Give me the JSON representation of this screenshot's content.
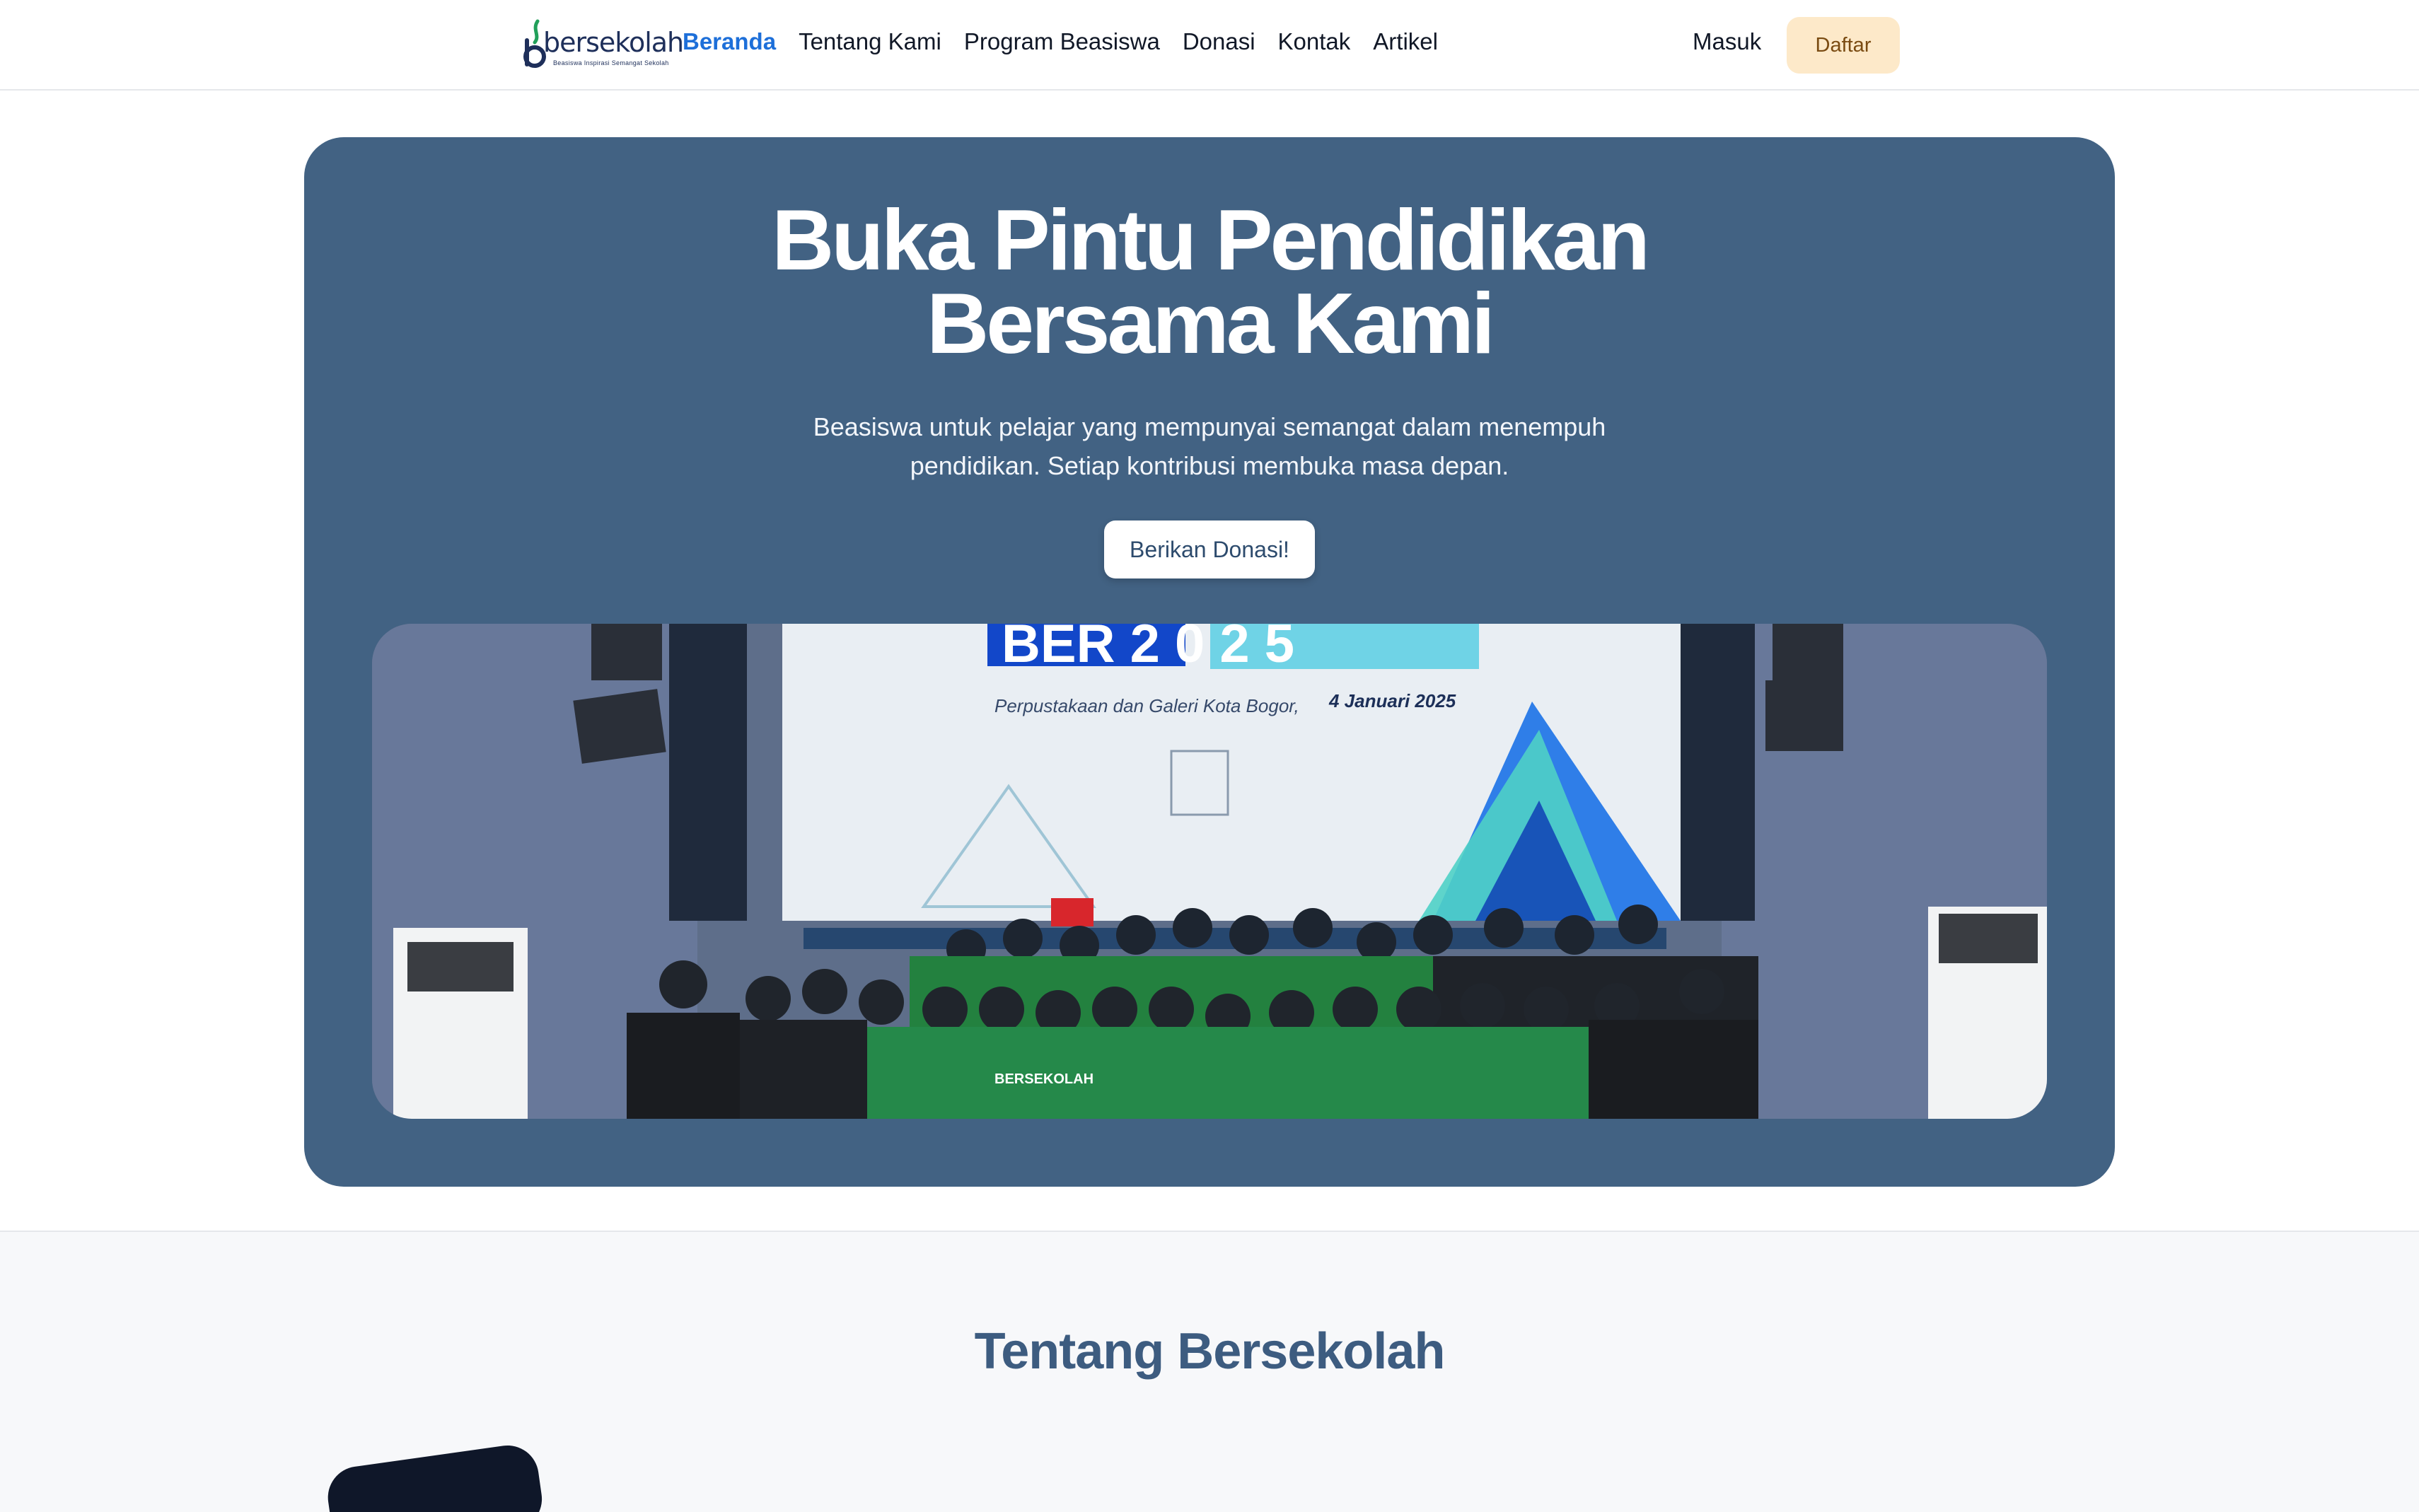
{
  "navbar": {
    "logo": {
      "text": "bersekolah",
      "tagline": "Beasiswa Inspirasi Semangat Sekolah",
      "color": "#1e2f5a"
    },
    "links": [
      {
        "label": "Beranda",
        "active": true
      },
      {
        "label": "Tentang Kami",
        "active": false
      },
      {
        "label": "Program Beasiswa",
        "active": false
      },
      {
        "label": "Donasi",
        "active": false
      },
      {
        "label": "Kontak",
        "active": false
      },
      {
        "label": "Artikel",
        "active": false
      }
    ],
    "login_label": "Masuk",
    "register_label": "Daftar",
    "active_color": "#1d6fd9"
  },
  "hero": {
    "title_line1": "Buka Pintu Pendidikan",
    "title_line2": "Bersama Kami",
    "subtitle_line1": "Beasiswa untuk pelajar yang mempunyai semangat dalam menempuh",
    "subtitle_line2": "pendidikan. Setiap kontribusi membuka masa depan.",
    "cta_label": "Berikan Donasi!",
    "background_color": "#426283",
    "photo": {
      "screen_text_top": "BER  2 0 2 5",
      "screen_caption": "Perpustakaan dan Galeri Kota Bogor,",
      "screen_date": "4 Januari 2025",
      "shirt_text": "BERSEKOLAH"
    }
  },
  "about": {
    "title": "Tentang Bersekolah",
    "title_color": "#3d5c80"
  }
}
